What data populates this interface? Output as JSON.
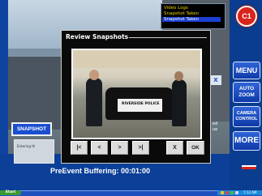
{
  "log": {
    "lines": [
      "Video Logs",
      "Snapshot Taken",
      "Snapshot Taken"
    ]
  },
  "logo": "C1",
  "right_buttons": {
    "menu": "MENU",
    "auto_zoom_line1": "AUTO",
    "auto_zoom_line2": "ZOOM",
    "camera_control_line1": "CAMERA",
    "camera_control_line2": "CONTROL",
    "more": "MORE"
  },
  "left": {
    "snapshot_label": "SNAPSHOT",
    "thumb_text": "Entering th"
  },
  "dialog": {
    "title": "Review Snapshots",
    "photo_car_text": "RIVERSIDE POLICE",
    "nav": {
      "first": "|<",
      "prev": "<",
      "next": ">",
      "last": ">|",
      "cancel": "X",
      "ok": "OK"
    }
  },
  "partial": {
    "x_label": "X",
    "text1": "ed",
    "text2": "ue"
  },
  "status": {
    "preevent": "PreEvent Buffering: 00:01:00"
  },
  "taskbar": {
    "start": "Start",
    "clock": "7:12 AM"
  },
  "colors": {
    "accent_blue": "#1a4fd0",
    "logo_red": "#d8241c",
    "log_yellow": "#e8d200"
  }
}
